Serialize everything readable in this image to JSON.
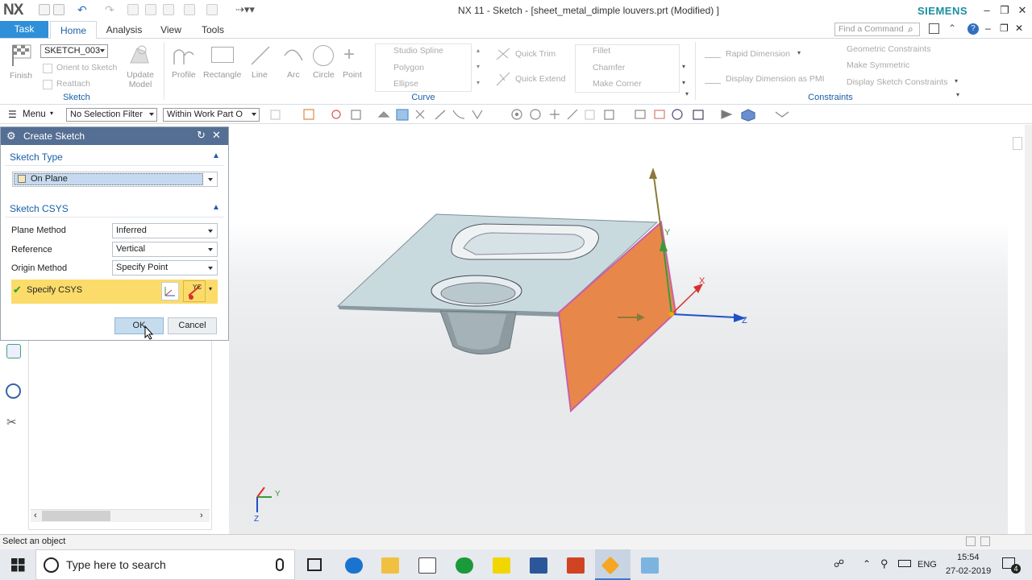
{
  "titlebar": {
    "logo": "NX",
    "title": "NX 11 - Sketch - [sheet_metal_dimple louvers.prt (Modified) ]",
    "brand": "SIEMENS",
    "brand_color": "#1a8fa0"
  },
  "tabs": {
    "task": "Task",
    "home": "Home",
    "analysis": "Analysis",
    "view": "View",
    "tools": "Tools",
    "find_placeholder": "Find a Command"
  },
  "ribbon": {
    "sketch_name": "SKETCH_003",
    "finish": "Finish",
    "orient": "Orient to Sketch",
    "reattach": "Reattach",
    "update_model": "Update Model",
    "sketch_group": "Sketch",
    "profile": "Profile",
    "rectangle": "Rectangle",
    "line": "Line",
    "arc": "Arc",
    "circle": "Circle",
    "point": "Point",
    "studio_spline": "Studio Spline",
    "polygon": "Polygon",
    "ellipse": "Ellipse",
    "quick_trim": "Quick Trim",
    "quick_extend": "Quick Extend",
    "fillet": "Fillet",
    "chamfer": "Chamfer",
    "make_corner": "Make Corner",
    "curve_group": "Curve",
    "rapid_dimension": "Rapid Dimension",
    "display_dimension_pmi": "Display Dimension as PMI",
    "geometric_constraints": "Geometric Constraints",
    "make_symmetric": "Make Symmetric",
    "display_sketch_constraints": "Display Sketch Constraints",
    "constraints_group": "Constraints"
  },
  "selbar": {
    "menu": "Menu",
    "filter": "No Selection Filter",
    "scope": "Within Work Part O"
  },
  "dialog": {
    "title": "Create Sketch",
    "sketch_type_header": "Sketch Type",
    "sketch_type_value": "On Plane",
    "csys_header": "Sketch CSYS",
    "plane_method_label": "Plane Method",
    "plane_method_value": "Inferred",
    "reference_label": "Reference",
    "reference_value": "Vertical",
    "origin_method_label": "Origin Method",
    "origin_method_value": "Specify Point",
    "specify_csys": "Specify CSYS",
    "ok": "OK",
    "cancel": "Cancel"
  },
  "viewport": {
    "axis_x": "X",
    "axis_y": "Y",
    "axis_z": "Z",
    "triad_y": "Y",
    "triad_z": "Z",
    "plane_color": "#e8874a"
  },
  "status": {
    "prompt": "Select an object"
  },
  "taskbar": {
    "search_placeholder": "Type here to search",
    "lang": "ENG",
    "time": "15:54",
    "date": "27-02-2019",
    "notifications": "4"
  }
}
